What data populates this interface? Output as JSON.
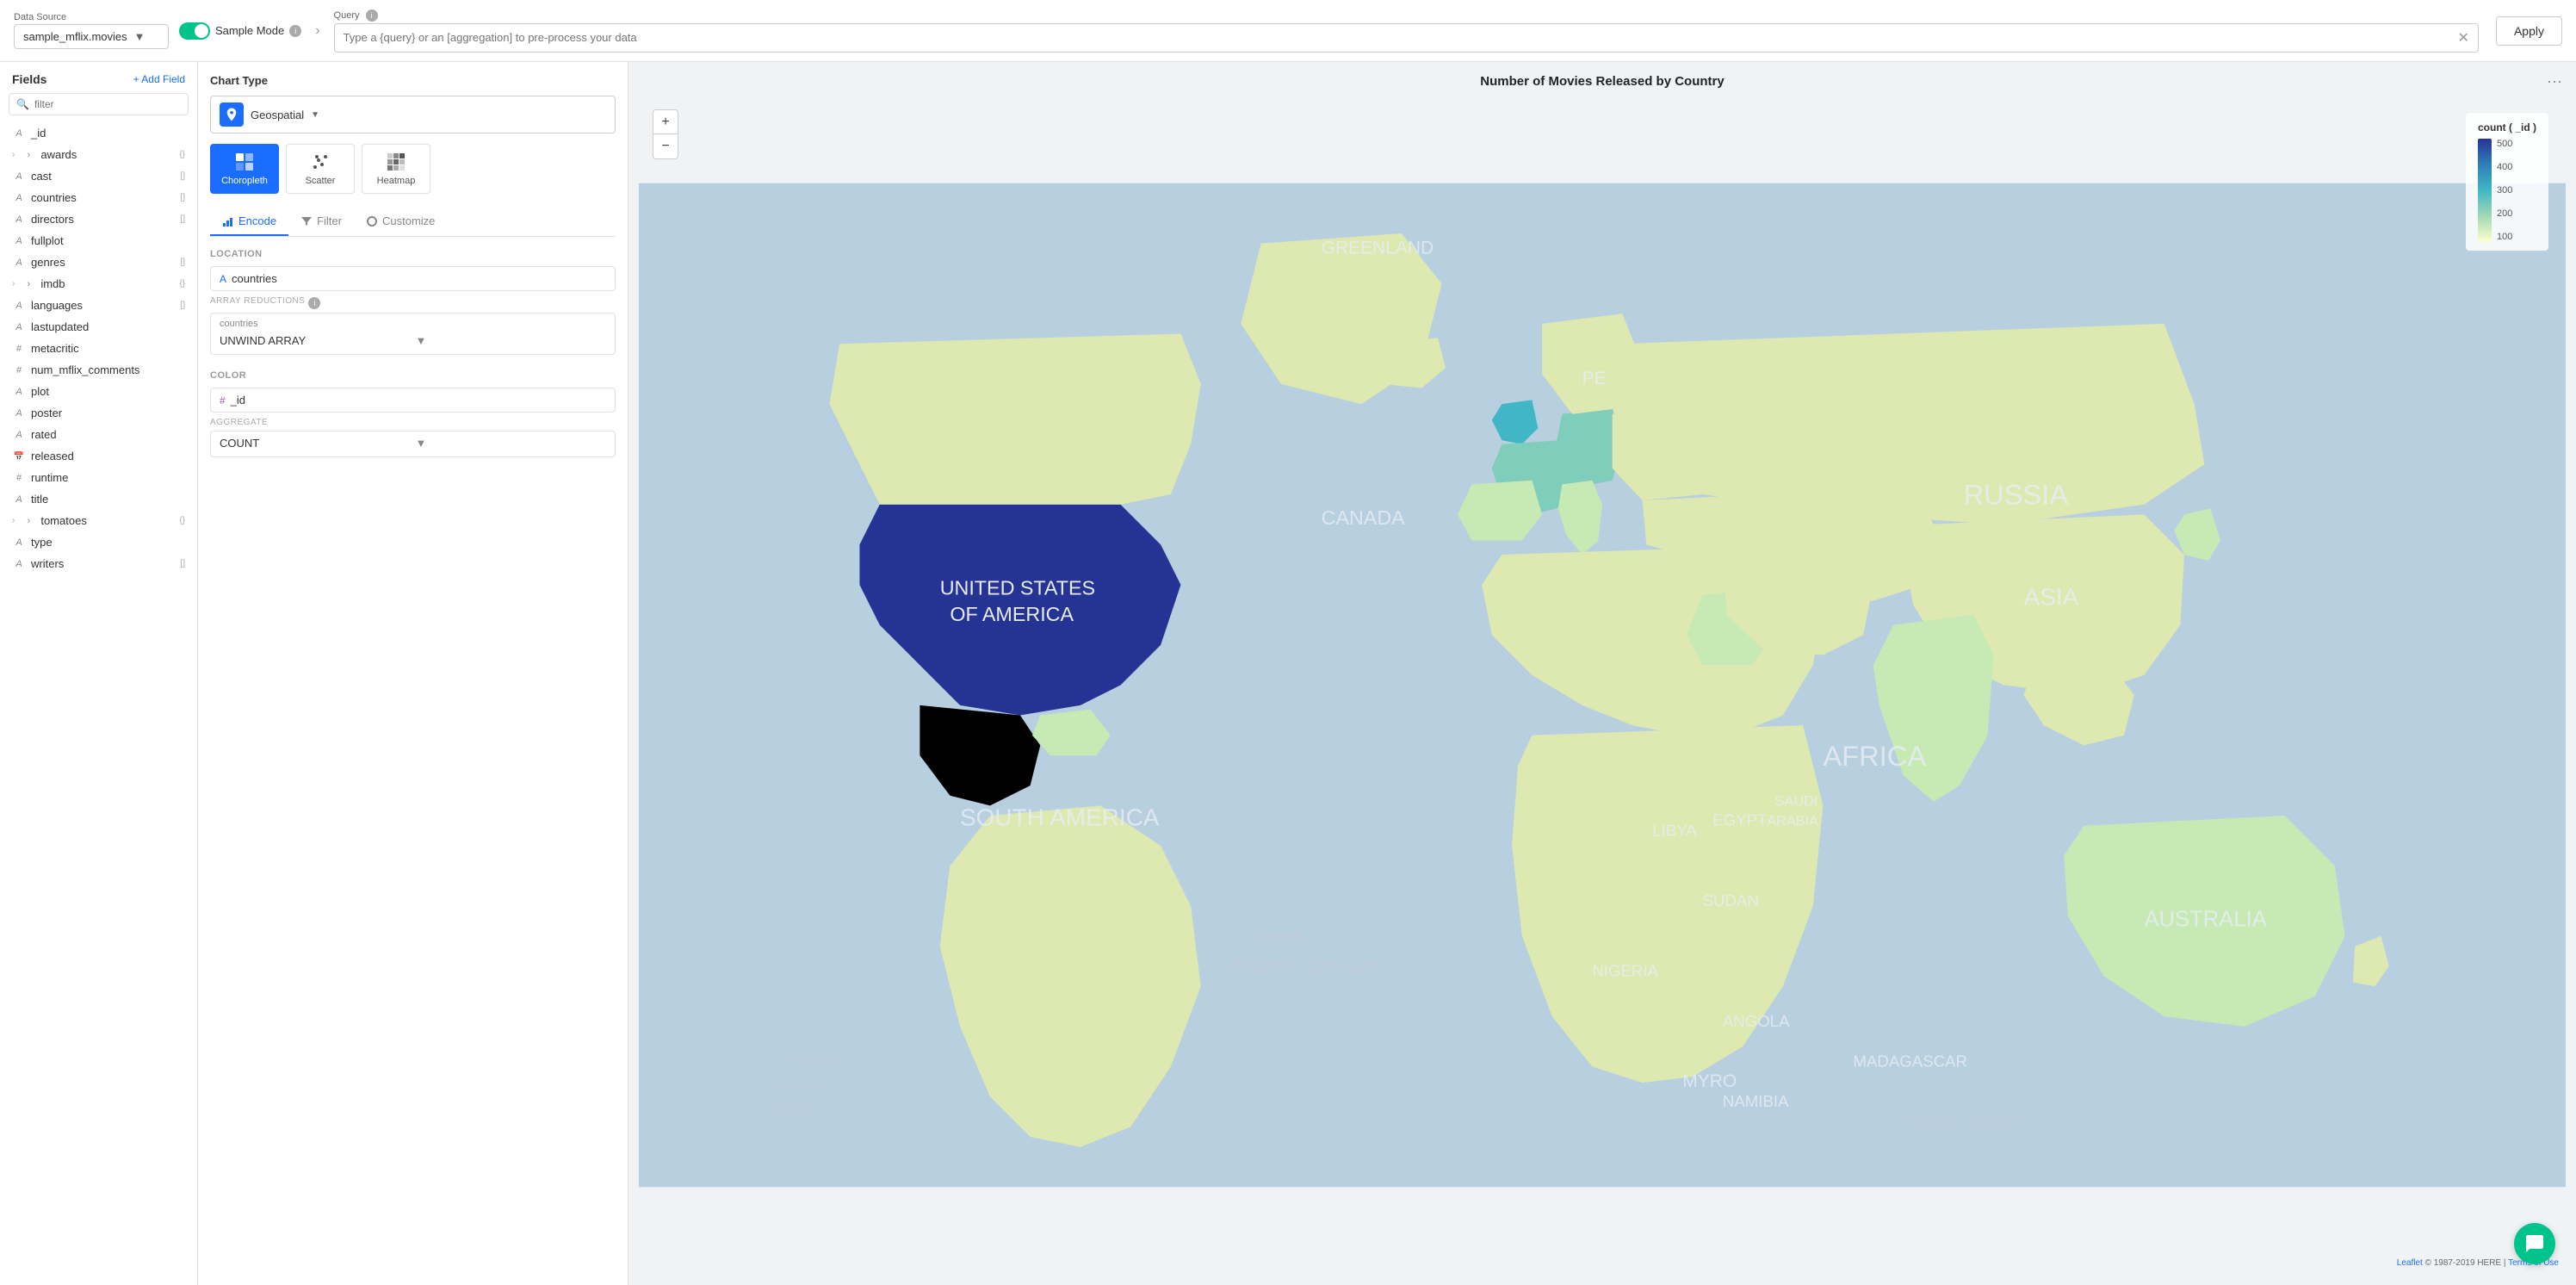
{
  "topbar": {
    "datasource_label": "Data Source",
    "sample_mode_label": "Sample Mode",
    "sample_mode_info": "i",
    "datasource_value": "sample_mflix.movies",
    "query_label": "Query",
    "query_info": "i",
    "query_placeholder": "Type a {query} or an [aggregation] to pre-process your data",
    "apply_label": "Apply"
  },
  "sidebar": {
    "title": "Fields",
    "add_field_label": "+ Add Field",
    "search_placeholder": "filter",
    "fields": [
      {
        "id": "f_id",
        "icon": "A",
        "name": "_id",
        "badge": "",
        "expand": false,
        "type": "string"
      },
      {
        "id": "f_awards",
        "icon": ">",
        "name": "awards",
        "badge": "{}",
        "expand": true,
        "type": "object"
      },
      {
        "id": "f_cast",
        "icon": "A",
        "name": "cast",
        "badge": "[]",
        "expand": false,
        "type": "array"
      },
      {
        "id": "f_countries",
        "icon": "A",
        "name": "countries",
        "badge": "[]",
        "expand": false,
        "type": "array"
      },
      {
        "id": "f_directors",
        "icon": "A",
        "name": "directors",
        "badge": "[]",
        "expand": false,
        "type": "array"
      },
      {
        "id": "f_fullplot",
        "icon": "A",
        "name": "fullplot",
        "badge": "",
        "expand": false,
        "type": "string"
      },
      {
        "id": "f_genres",
        "icon": "A",
        "name": "genres",
        "badge": "[]",
        "expand": false,
        "type": "array"
      },
      {
        "id": "f_imdb",
        "icon": ">",
        "name": "imdb",
        "badge": "{}",
        "expand": true,
        "type": "object"
      },
      {
        "id": "f_languages",
        "icon": "A",
        "name": "languages",
        "badge": "[]",
        "expand": false,
        "type": "array"
      },
      {
        "id": "f_lastupdated",
        "icon": "A",
        "name": "lastupdated",
        "badge": "",
        "expand": false,
        "type": "string"
      },
      {
        "id": "f_metacritic",
        "icon": "#",
        "name": "metacritic",
        "badge": "",
        "expand": false,
        "type": "number"
      },
      {
        "id": "f_num_mflix",
        "icon": "#",
        "name": "num_mflix_comments",
        "badge": "",
        "expand": false,
        "type": "number"
      },
      {
        "id": "f_plot",
        "icon": "A",
        "name": "plot",
        "badge": "",
        "expand": false,
        "type": "string"
      },
      {
        "id": "f_poster",
        "icon": "A",
        "name": "poster",
        "badge": "",
        "expand": false,
        "type": "string"
      },
      {
        "id": "f_rated",
        "icon": "A",
        "name": "rated",
        "badge": "",
        "expand": false,
        "type": "string"
      },
      {
        "id": "f_released",
        "icon": "cal",
        "name": "released",
        "badge": "",
        "expand": false,
        "type": "date"
      },
      {
        "id": "f_runtime",
        "icon": "#",
        "name": "runtime",
        "badge": "",
        "expand": false,
        "type": "number"
      },
      {
        "id": "f_title",
        "icon": "A",
        "name": "title",
        "badge": "",
        "expand": false,
        "type": "string"
      },
      {
        "id": "f_tomatoes",
        "icon": ">",
        "name": "tomatoes",
        "badge": "{}",
        "expand": true,
        "type": "object"
      },
      {
        "id": "f_type",
        "icon": "A",
        "name": "type",
        "badge": "",
        "expand": false,
        "type": "string"
      },
      {
        "id": "f_writers",
        "icon": "A",
        "name": "writers",
        "badge": "[]",
        "expand": false,
        "type": "array"
      }
    ]
  },
  "encode_panel": {
    "chart_type_title": "Chart Type",
    "chart_type_selected": "Geospatial",
    "chart_types": [
      {
        "id": "choropleth",
        "label": "Choropleth",
        "active": true
      },
      {
        "id": "scatter",
        "label": "Scatter",
        "active": false
      },
      {
        "id": "heatmap",
        "label": "Heatmap",
        "active": false
      }
    ],
    "tabs": [
      {
        "id": "encode",
        "label": "Encode",
        "active": true
      },
      {
        "id": "filter",
        "label": "Filter",
        "active": false
      },
      {
        "id": "customize",
        "label": "Customize",
        "active": false
      }
    ],
    "location_section": {
      "title": "Location",
      "field_icon": "A",
      "field_name": "countries",
      "array_reductions_label": "ARRAY REDUCTIONS",
      "array_reductions_info": "i",
      "reduction_field_label": "countries",
      "reduction_value": "UNWIND ARRAY"
    },
    "color_section": {
      "title": "Color",
      "field_icon": "#",
      "field_name": "_id",
      "aggregate_label": "AGGREGATE",
      "aggregate_value": "COUNT"
    }
  },
  "map": {
    "chart_title": "Number of Movies Released by Country",
    "more_icon": "•••",
    "zoom_in": "+",
    "zoom_out": "−",
    "legend_title": "count ( _id )",
    "legend_values": [
      "500",
      "400",
      "300",
      "200",
      "100"
    ],
    "attribution_text": "Leaflet",
    "attribution_copy": "© 1987-2019 HERE",
    "attribution_terms": "Terms of Use"
  },
  "chat": {
    "label": "Chat"
  }
}
